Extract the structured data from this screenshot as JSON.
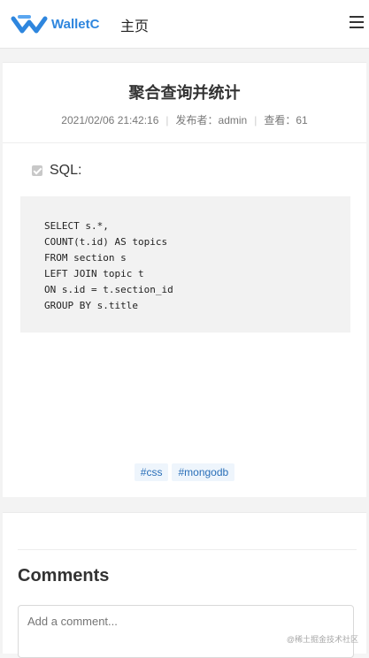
{
  "header": {
    "logo_text": "WalletC",
    "nav_home": "主页",
    "brand_color": "#2e86de"
  },
  "post": {
    "title": "聚合查询并统计",
    "date": "2021/02/06 21:42:16",
    "author_label": "发布者：admin",
    "views_label": "查看：61",
    "sql_label": "SQL:",
    "code_lines": [
      "SELECT s.*,",
      "COUNT(t.id) AS topics",
      "FROM section s",
      "LEFT JOIN topic t",
      "ON s.id = t.section_id",
      "GROUP BY s.title"
    ],
    "tags": [
      "#css",
      "#mongodb"
    ]
  },
  "comments": {
    "title": "Comments",
    "input_placeholder": "Add a comment..."
  },
  "watermark": "@稀土掘金技术社区"
}
